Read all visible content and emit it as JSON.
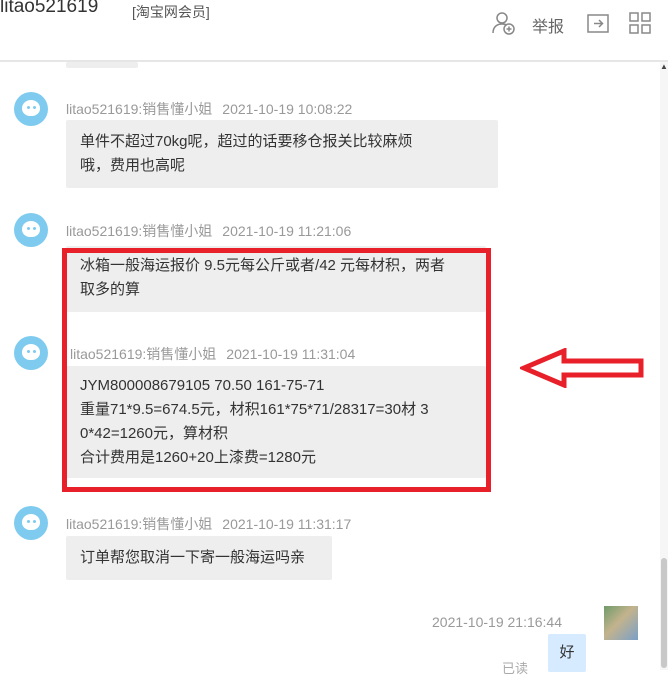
{
  "header": {
    "username": "litao521619",
    "member_badge": "[淘宝网会员]",
    "report_label": "举报",
    "icons": [
      "add-contact-icon",
      "share-icon",
      "grid-icon"
    ]
  },
  "messages": [
    {
      "sender": "litao521619:销售懂小姐",
      "time": "2021-10-19 10:08:22",
      "lines": [
        "单件不超过70kg呢，超过的话要移仓报关比较麻烦",
        "哦，费用也高呢"
      ]
    },
    {
      "sender": "litao521619:销售懂小姐",
      "time": "2021-10-19 11:21:06",
      "lines": [
        "冰箱一般海运报价 9.5元每公斤或者/42 元每材积，两者",
        "取多的算"
      ]
    },
    {
      "sender": "litao521619:销售懂小姐",
      "time": "2021-10-19 11:31:04",
      "lines": [
        "JYM800008679105 70.50  161-75-71",
        "重量71*9.5=674.5元，材积161*75*71/28317=30材 3",
        "0*42=1260元，算材积",
        "合计费用是1260+20上漆费=1280元"
      ]
    },
    {
      "sender": "litao521619:销售懂小姐",
      "time": "2021-10-19 11:31:17",
      "lines": [
        "订单帮您取消一下寄一般海运吗亲"
      ]
    }
  ],
  "self_message": {
    "time": "2021-10-19 21:16:44",
    "text": "好",
    "status": "已读"
  },
  "colors": {
    "highlight_border": "#e8202a",
    "bubble_bg": "#eeeeee",
    "avatar_blue": "#7ecbef"
  }
}
